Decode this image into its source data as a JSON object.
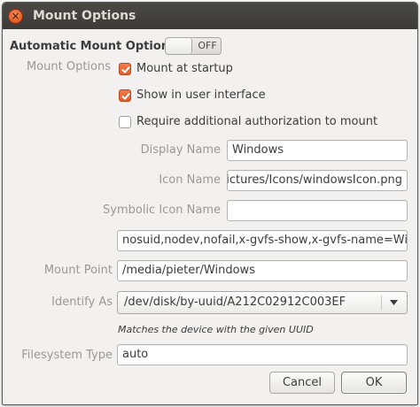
{
  "window": {
    "title": "Mount Options",
    "close_glyph": "×"
  },
  "automatic": {
    "label": "Automatic Mount Options",
    "switch_state": "OFF"
  },
  "mount_options": {
    "label": "Mount Options",
    "checkboxes": [
      {
        "label": "Mount at startup",
        "checked": true
      },
      {
        "label": "Show in user interface",
        "checked": true
      },
      {
        "label": "Require additional authorization to mount",
        "checked": false
      }
    ]
  },
  "fields": {
    "display_name": {
      "label": "Display Name",
      "value": "Windows"
    },
    "icon_name": {
      "label": "Icon Name",
      "value": "/home/pieter/Pictures/Icons/windowsIcon.png"
    },
    "symbolic_icon_name": {
      "label": "Symbolic Icon Name",
      "value": ""
    },
    "options": {
      "value": "nosuid,nodev,nofail,x-gvfs-show,x-gvfs-name=Windows"
    },
    "mount_point": {
      "label": "Mount Point",
      "value": "/media/pieter/Windows"
    },
    "identify_as": {
      "label": "Identify As",
      "value": "/dev/disk/by-uuid/A212C02912C003EF",
      "hint": "Matches the device with the given UUID"
    },
    "filesystem_type": {
      "label": "Filesystem Type",
      "value": "auto"
    }
  },
  "buttons": {
    "cancel": "Cancel",
    "ok": "OK"
  },
  "colors": {
    "accent": "#e05e2b",
    "titlebar": "#3c3b37",
    "background": "#f2f1f0"
  },
  "icons": {
    "close": "close-icon",
    "check": "check-icon",
    "dropdown": "chevron-down-icon"
  }
}
